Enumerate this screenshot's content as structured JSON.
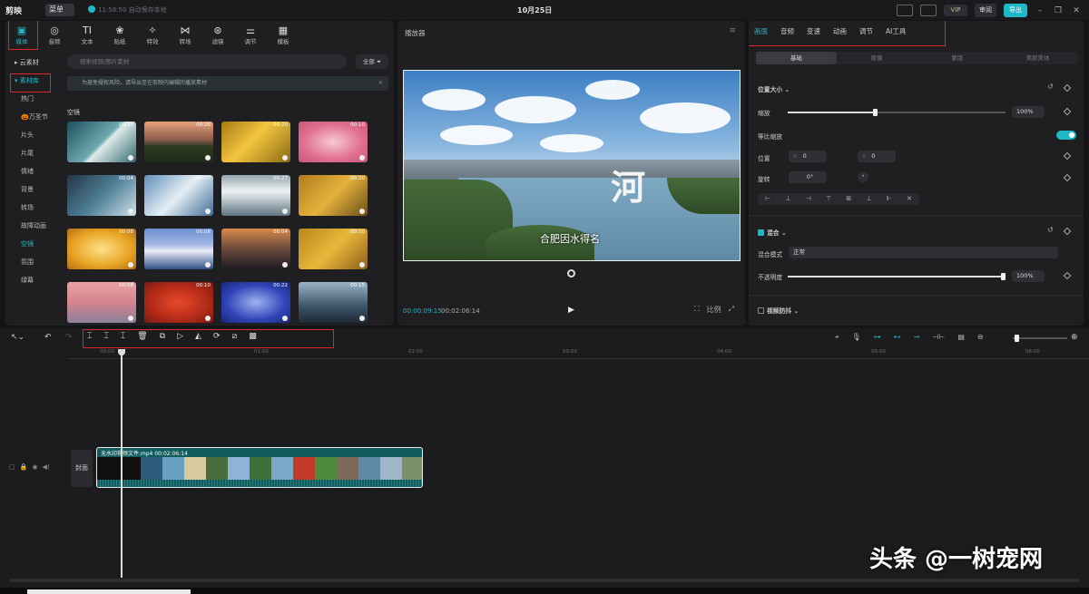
{
  "app": {
    "logo": "剪映",
    "menu": "菜单",
    "autosave": "11:58:50 自动保存本地",
    "date": "10月25日",
    "vip": "VIP",
    "review": "审阅",
    "export": "导出"
  },
  "media_tools": [
    {
      "icon": "▣",
      "label": "媒体"
    },
    {
      "icon": "◎",
      "label": "音频"
    },
    {
      "icon": "TI",
      "label": "文本"
    },
    {
      "icon": "❀",
      "label": "贴纸"
    },
    {
      "icon": "✧",
      "label": "特效"
    },
    {
      "icon": "⋈",
      "label": "转场"
    },
    {
      "icon": "⊛",
      "label": "滤镜"
    },
    {
      "icon": "⚌",
      "label": "调节"
    },
    {
      "icon": "▦",
      "label": "模板"
    }
  ],
  "sidebar": {
    "cloud": "▸ 云素材",
    "library": "▾ 素材库",
    "items": [
      "热门",
      "🎃万圣节",
      "片头",
      "片尾",
      "情绪",
      "背景",
      "转场",
      "故障动画",
      "空镜",
      "氛围",
      "绿幕"
    ]
  },
  "search": {
    "placeholder": "搜索视频/图片素材"
  },
  "filter": "全部 ⏷",
  "notice": "为避免侵权风险，请导出至在剪映内编辑的播放素材",
  "section": "空镜",
  "thumbs": [
    {
      "dur": "00:23",
      "bg": "linear-gradient(135deg,#1d4f5c,#6fa9b1 50%,#dfe9e8 55%,#2e6a72)"
    },
    {
      "dur": "00:26",
      "bg": "linear-gradient(#e9a07a,#8a5a4c 45%,#2e3d24 60%,#1f2a18)"
    },
    {
      "dur": "00:20",
      "bg": "linear-gradient(135deg,#a87b14,#f2c540 45%,#8a6a10)"
    },
    {
      "dur": "00:10",
      "bg": "radial-gradient(#f7c9d3,#e0708f 60%,#c8567a)"
    },
    {
      "dur": "00:04",
      "bg": "linear-gradient(135deg,#253545,#4d7d96 50%,#cfe1e8)"
    },
    {
      "dur": "00:07",
      "bg": "linear-gradient(135deg,#5f8fb8,#e4eef5 50%,#3f6d95)"
    },
    {
      "dur": "00:27",
      "bg": "linear-gradient(#94a5ae,#eef2f4 40%,#5f7682)"
    },
    {
      "dur": "00:20",
      "bg": "linear-gradient(135deg,#b07b1c,#e4b23d 50%,#6a4e16)"
    },
    {
      "dur": "00:08",
      "bg": "radial-gradient(#ffe08a,#e8a423 60%,#b26e14)"
    },
    {
      "dur": "00:08",
      "bg": "linear-gradient(#6b8fd1,#a7b9e6 40%,#e9ecf6 55%,#2e4f86)"
    },
    {
      "dur": "00:04",
      "bg": "linear-gradient(#d88a4a,#6b4a3c 50%,#1e1a20)"
    },
    {
      "dur": "00:10",
      "bg": "linear-gradient(135deg,#b8861e,#e8b83a 50%,#8e5e1a)"
    },
    {
      "dur": "00:08",
      "bg": "linear-gradient(#e9a3a3,#d5848e 50%,#8c7f9a)"
    },
    {
      "dur": "00:10",
      "bg": "radial-gradient(#e84a2a,#b22a18 60%,#7a1a12)"
    },
    {
      "dur": "00:22",
      "bg": "radial-gradient(#9fb2f2,#3046b8 60%,#1a2678)"
    },
    {
      "dur": "00:15",
      "bg": "linear-gradient(#9ab4c8,#3d5468 60%,#1d2a36)"
    }
  ],
  "player": {
    "title": "播放器",
    "calligraphy": "河",
    "subtitle": "合肥因水得名",
    "time_current": "00:00:09:15",
    "time_total": "00:02:06:14",
    "play": "▶",
    "icons": [
      "⛶",
      "比例",
      "⤢"
    ]
  },
  "props": {
    "tabs": [
      "画面",
      "音频",
      "变速",
      "动画",
      "调节",
      "AI工具"
    ],
    "subtabs": [
      "基础",
      "抠像",
      "蒙版",
      "美颜美体"
    ],
    "pos_size": "位置大小 ⌄",
    "scale": "缩放",
    "scale_val": "100%",
    "scale_pct": 0.4,
    "uniform": "等比缩放",
    "position": "位置",
    "x_label": "X",
    "x_val": "0",
    "y_label": "Y",
    "y_val": "0",
    "rotate": "旋转",
    "rotate_val": "0°",
    "align_icons": [
      "⊢",
      "⊥",
      "⊣",
      "⊤",
      "⊞",
      "⊥",
      "⊩",
      "✕"
    ],
    "blend": "混合 ⌄",
    "blend_mode": "混合模式",
    "blend_val": "正常",
    "opacity": "不透明度",
    "opacity_val": "100%",
    "opacity_pct": 1.0,
    "stabilize": "视频防抖 ⌄"
  },
  "timeline": {
    "ticks": [
      "00:00",
      "01:00",
      "02:00",
      "03:00",
      "04:00",
      "05:00",
      "06:00"
    ],
    "cover": "封面",
    "clip_label": "无水印视频文件.mp4   00:02:06:14",
    "frames": [
      "#101010",
      "#101010",
      "#2b5d7a",
      "#6aa0c2",
      "#d9c99e",
      "#4a6d3e",
      "#8fb3d6",
      "#3f6f3a",
      "#7aa8c6",
      "#c23a2a",
      "#4f8a3e",
      "#7d6b5a",
      "#5e8aa8",
      "#9eb6c8",
      "#7a8f6a"
    ],
    "edit_icons": [
      "⌶",
      "⌶",
      "⌶",
      "🗑",
      "⧉",
      "▷",
      "◭",
      "⟳",
      "⧄",
      "▩"
    ]
  },
  "watermark": "头条 @一树宠网"
}
